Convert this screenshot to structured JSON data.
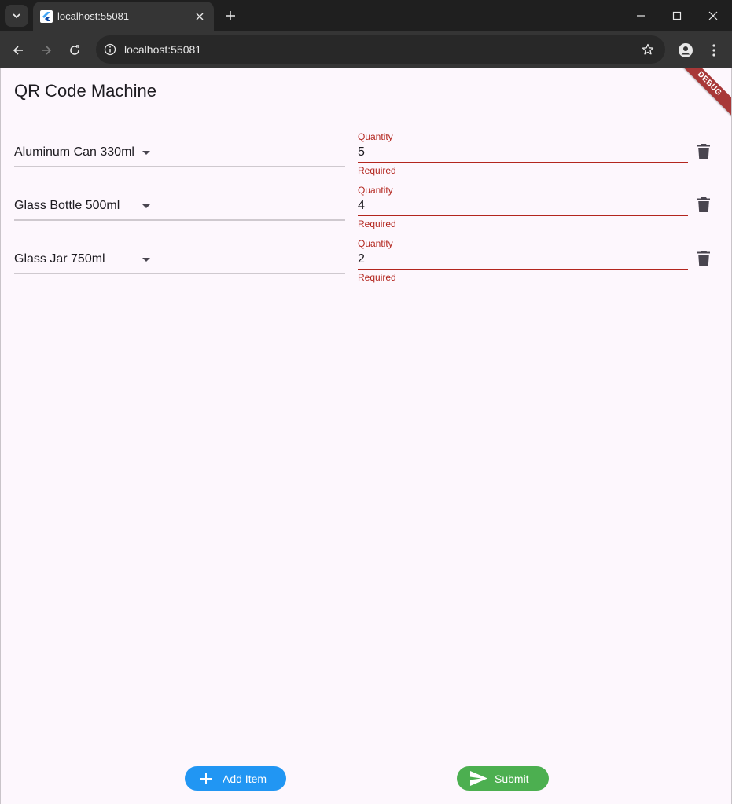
{
  "browser": {
    "tab_title": "localhost:55081",
    "url": "localhost:55081"
  },
  "app": {
    "title": "QR Code Machine",
    "debug_banner": "DEBUG"
  },
  "items": [
    {
      "product": "Aluminum Can 330ml",
      "quantity_label": "Quantity",
      "quantity": "5",
      "error": "Required"
    },
    {
      "product": "Glass Bottle 500ml",
      "quantity_label": "Quantity",
      "quantity": "4",
      "error": "Required"
    },
    {
      "product": "Glass Jar 750ml",
      "quantity_label": "Quantity",
      "quantity": "2",
      "error": "Required"
    }
  ],
  "buttons": {
    "add_item": "Add Item",
    "submit": "Submit"
  },
  "colors": {
    "error": "#b3261e",
    "add_button": "#2196f3",
    "submit_button": "#4caf50",
    "background": "#fdf7fd"
  },
  "icons": {
    "delete": "trash-icon",
    "add": "plus-icon",
    "submit": "send-icon"
  }
}
